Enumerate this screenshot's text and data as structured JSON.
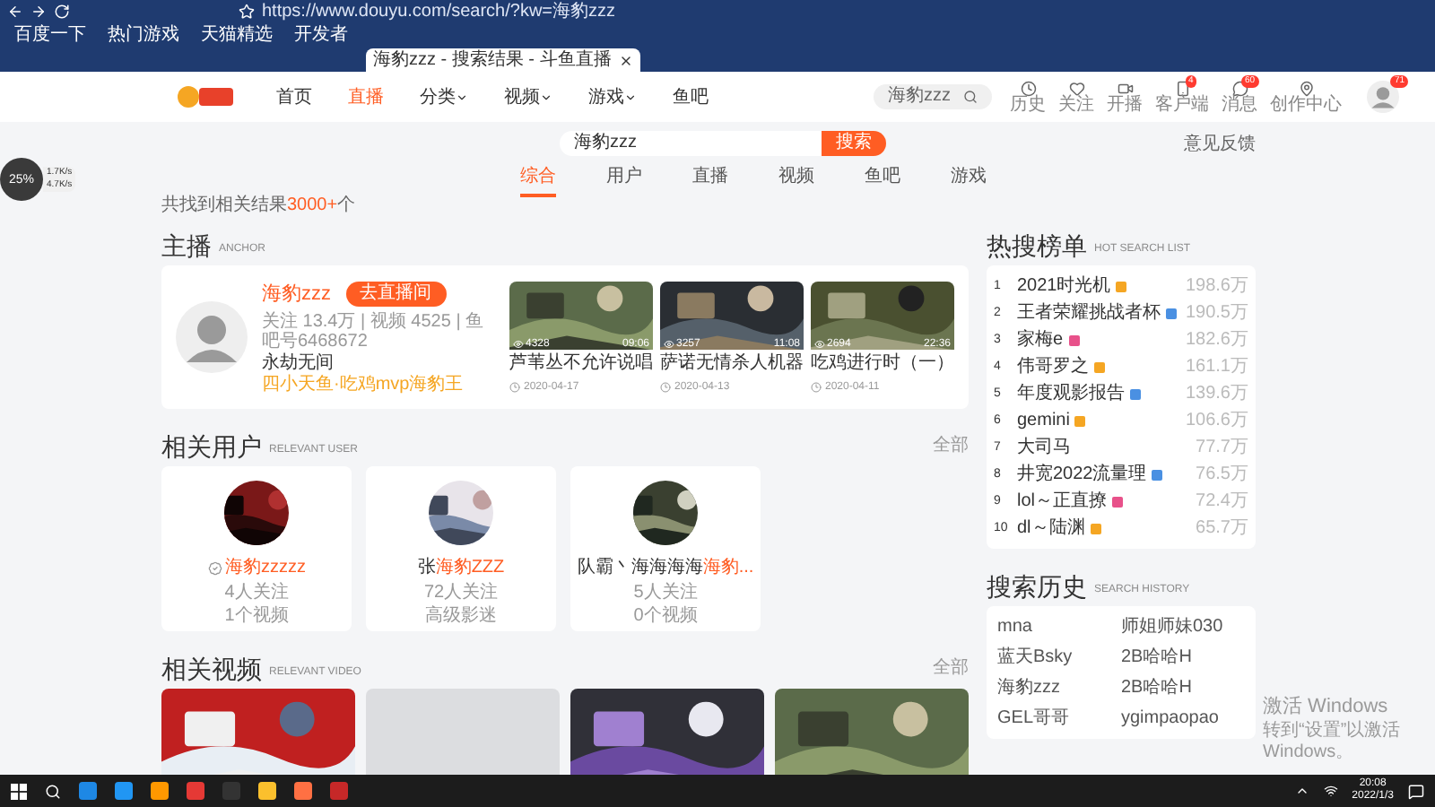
{
  "browser": {
    "address": "https://www.douyu.com/search/?kw=海豹zzz",
    "bookmarks": [
      "百度一下",
      "热门游戏",
      "天猫精选",
      "开发者"
    ],
    "tabs": [
      {
        "title": "海豹zzz - 搜索结果 - 斗鱼直播",
        "selected": true
      }
    ]
  },
  "net_widget": {
    "percent": "25%",
    "up": "1.7K/s",
    "down": "4.7K/s"
  },
  "site_header": {
    "nav": [
      {
        "label": "首页",
        "selected": false,
        "dropdown": false
      },
      {
        "label": "直播",
        "selected": true,
        "dropdown": false
      },
      {
        "label": "分类",
        "selected": false,
        "dropdown": true
      },
      {
        "label": "视频",
        "selected": false,
        "dropdown": true
      },
      {
        "label": "游戏",
        "selected": false,
        "dropdown": true
      },
      {
        "label": "鱼吧",
        "selected": false,
        "dropdown": false
      }
    ],
    "search_value": "海豹zzz",
    "actions": [
      {
        "label": "历史",
        "kind": "clock"
      },
      {
        "label": "关注",
        "kind": "heart"
      },
      {
        "label": "开播",
        "kind": "video"
      },
      {
        "label": "客户端",
        "kind": "phone",
        "badge": "4"
      },
      {
        "label": "消息",
        "kind": "chat",
        "badge": "60"
      },
      {
        "label": "创作中心",
        "kind": "pin"
      }
    ],
    "avatar_badge": "71"
  },
  "search": {
    "value": "海豹zzz",
    "button": "搜索"
  },
  "feedback": "意见反馈",
  "tabs": [
    {
      "label": "综合",
      "selected": true
    },
    {
      "label": "用户",
      "selected": false
    },
    {
      "label": "直播",
      "selected": false
    },
    {
      "label": "视频",
      "selected": false
    },
    {
      "label": "鱼吧",
      "selected": false
    },
    {
      "label": "游戏",
      "selected": false
    }
  ],
  "result_count": {
    "prefix": "共找到相关结果",
    "count": "3000+",
    "suffix": "个"
  },
  "anchor": {
    "title": "主播",
    "subtitle": "ANCHOR",
    "name": "海豹zzz",
    "button": "去直播间",
    "stats": "关注 13.4万 | 视频 4525 | 鱼吧号6468672",
    "game": "永劫无间",
    "honor": "四小天鱼·吃鸡mvp海豹王",
    "videos": [
      {
        "views": "4328",
        "duration": "09:06",
        "title": "芦苇丛不允许说唱",
        "date": "2020-04-17"
      },
      {
        "views": "3257",
        "duration": "11:08",
        "title": "萨诺无情杀人机器",
        "date": "2020-04-13"
      },
      {
        "views": "2694",
        "duration": "22:36",
        "title": "吃鸡进行时（一）",
        "date": "2020-04-11"
      }
    ]
  },
  "hot_search": {
    "title": "热搜榜单",
    "subtitle": "HOT SEARCH LIST",
    "items": [
      {
        "rank": "1",
        "term": "2021时光机",
        "color": "#f5a623",
        "value": "198.6万"
      },
      {
        "rank": "2",
        "term": "王者荣耀挑战者杯",
        "color": "#4a90e2",
        "value": "190.5万"
      },
      {
        "rank": "3",
        "term": "家梅e",
        "color": "#e8518a",
        "value": "182.6万"
      },
      {
        "rank": "4",
        "term": "伟哥罗之",
        "color": "#f5a623",
        "value": "161.1万"
      },
      {
        "rank": "5",
        "term": "年度观影报告",
        "color": "#4a90e2",
        "value": "139.6万"
      },
      {
        "rank": "6",
        "term": "gemini",
        "color": "#f5a623",
        "value": "106.6万"
      },
      {
        "rank": "7",
        "term": "大司马",
        "value": "77.7万"
      },
      {
        "rank": "8",
        "term": "井宽2022流量理",
        "color": "#4a90e2",
        "value": "76.5万"
      },
      {
        "rank": "9",
        "term": "lol～正直撩",
        "color": "#e8518a",
        "value": "72.4万"
      },
      {
        "rank": "10",
        "term": "dl～陆渊",
        "color": "#f5a623",
        "value": "65.7万"
      }
    ]
  },
  "users": {
    "title": "相关用户",
    "subtitle": "RELEVANT USER",
    "more": "全部",
    "items": [
      {
        "name_parts": [
          {
            "text": "海豹zzzzz",
            "highlight": true
          }
        ],
        "verified": true,
        "followers": "4人关注",
        "detail": "1个视频"
      },
      {
        "name_parts": [
          {
            "text": "张",
            "highlight": false
          },
          {
            "text": "海豹ZZZ",
            "highlight": true
          }
        ],
        "verified": false,
        "followers": "72人关注",
        "detail": "高级影迷"
      },
      {
        "name_parts": [
          {
            "text": "队霸丶海海海海",
            "highlight": false
          },
          {
            "text": "海豹...",
            "highlight": true
          }
        ],
        "verified": false,
        "followers": "5人关注",
        "detail": "0个视频"
      }
    ]
  },
  "videos": {
    "title": "相关视频",
    "subtitle": "RELEVANT VIDEO",
    "more": "全部",
    "items": [
      {
        "kind": "picture"
      },
      {
        "kind": "placeholder"
      },
      {
        "kind": "picture"
      },
      {
        "kind": "picture"
      }
    ]
  },
  "history": {
    "title": "搜索历史",
    "subtitle": "SEARCH HISTORY",
    "items": [
      [
        "mna",
        "师姐师妹030"
      ],
      [
        "蓝天Bsky",
        "2B哈哈H"
      ],
      [
        "海豹zzz",
        "2B哈哈H"
      ],
      [
        "GEL哥哥",
        "ygimpaopao"
      ]
    ]
  },
  "windows_notice": {
    "title": "激活 Windows",
    "text": "转到“设置”以激活 Windows。"
  },
  "taskbar": {
    "time": "20:08",
    "date": "2022/1/3"
  }
}
